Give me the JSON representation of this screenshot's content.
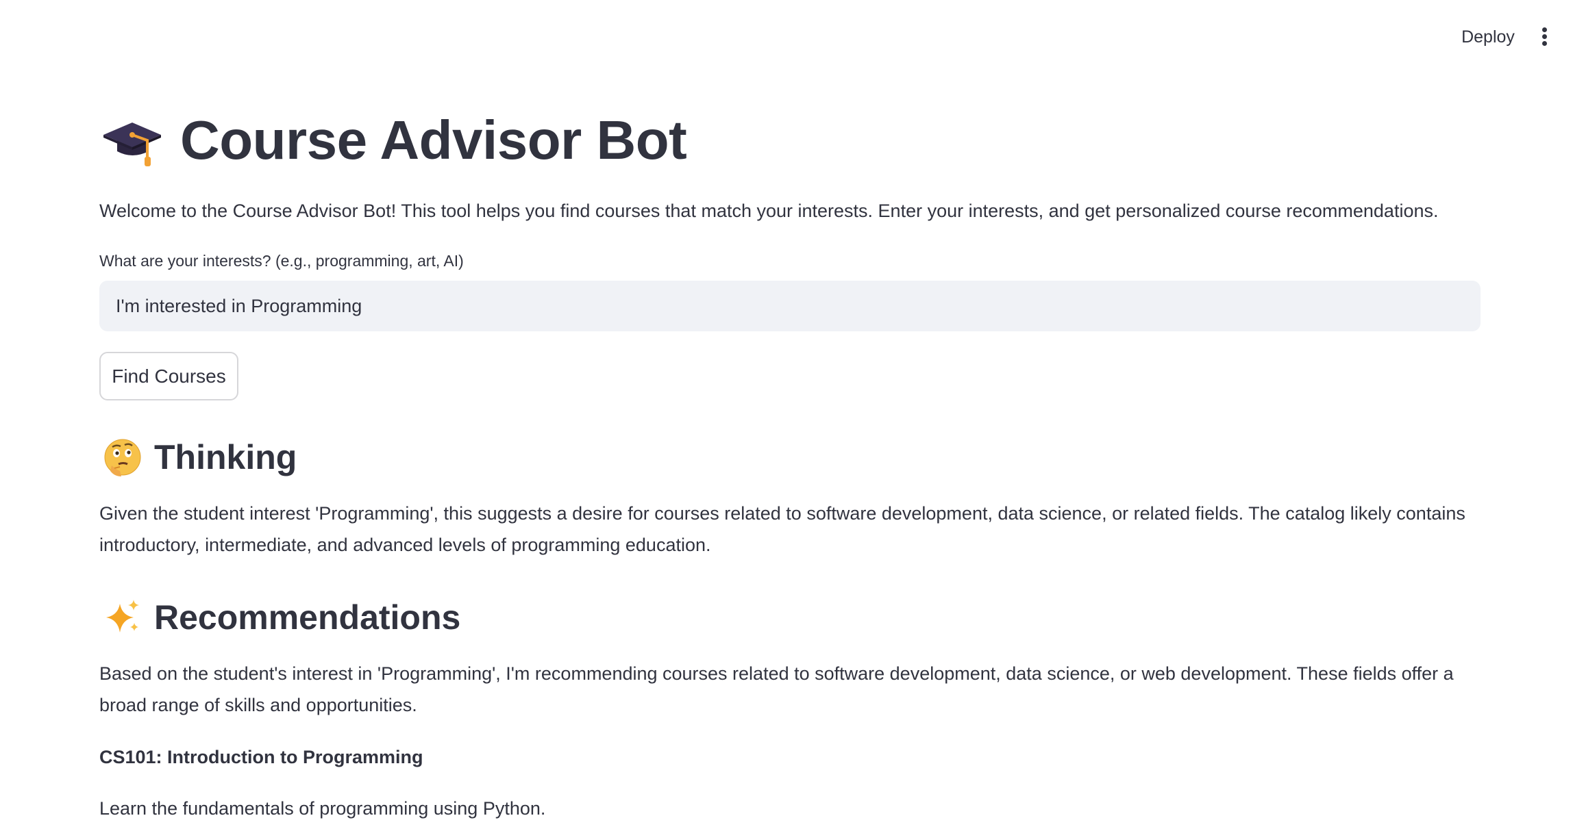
{
  "header": {
    "deploy_label": "Deploy",
    "menu_icon": "vertical-ellipsis-icon"
  },
  "page": {
    "title_icon": "graduation-cap-icon",
    "title": "Course Advisor Bot",
    "welcome": "Welcome to the Course Advisor Bot! This tool helps you find courses that match your interests. Enter your interests, and get personalized course recommendations."
  },
  "form": {
    "label": "What are your interests? (e.g., programming, art, AI)",
    "value": "I'm interested in Programming",
    "submit_label": "Find Courses"
  },
  "thinking": {
    "icon": "thinking-face-icon",
    "heading": "Thinking",
    "text": "Given the student interest 'Programming', this suggests a desire for courses related to software development, data science, or related fields. The catalog likely contains introductory, intermediate, and advanced levels of programming education."
  },
  "recommendations": {
    "icon": "sparkles-icon",
    "heading": "Recommendations",
    "text": "Based on the student's interest in 'Programming', I'm recommending courses related to software development, data science, or web development. These fields offer a broad range of skills and opportunities.",
    "courses": [
      {
        "title": "CS101: Introduction to Programming",
        "description": "Learn the fundamentals of programming using Python."
      }
    ]
  },
  "colors": {
    "text": "#31333f",
    "input_bg": "#f0f2f6",
    "button_border": "#d6d6d9",
    "background": "#ffffff"
  }
}
